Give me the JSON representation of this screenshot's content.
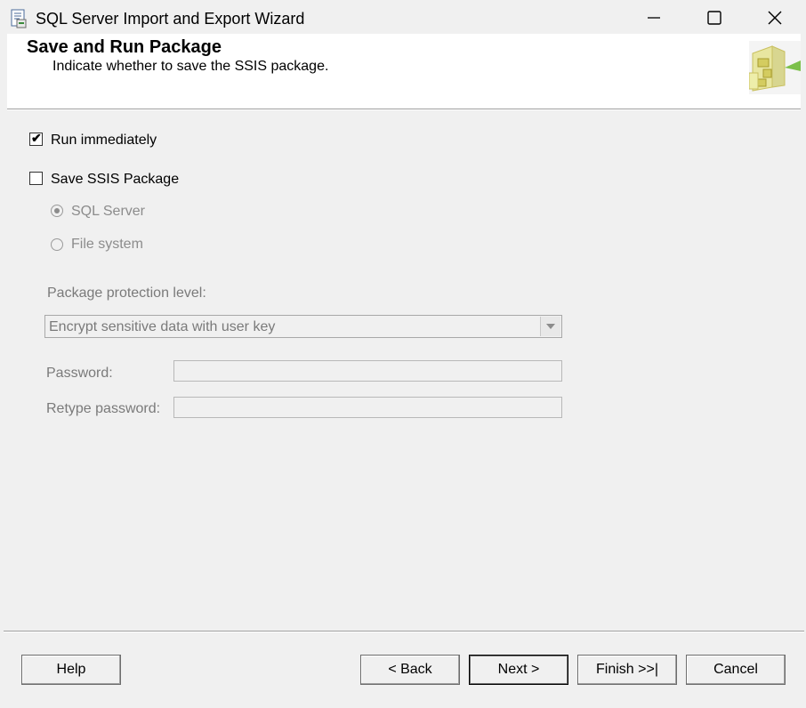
{
  "window": {
    "title": "SQL Server Import and Export Wizard",
    "controls": [
      "minimize",
      "maximize",
      "close"
    ]
  },
  "header": {
    "title": "Save and Run Package",
    "subtitle": "Indicate whether to save the SSIS package."
  },
  "options": {
    "run_immediately": {
      "label": "Run immediately",
      "checked": true
    },
    "save_package": {
      "label": "Save SSIS Package",
      "checked": false
    },
    "sql_server": {
      "label": "SQL Server",
      "selected": true,
      "enabled": false
    },
    "file_system": {
      "label": "File system",
      "selected": false,
      "enabled": false
    }
  },
  "protection": {
    "label": "Package protection level:",
    "selected": "Encrypt sensitive data with user key"
  },
  "password": {
    "label": "Password:",
    "value": ""
  },
  "retype_password": {
    "label": "Retype password:",
    "value": ""
  },
  "buttons": {
    "help": "Help",
    "back": "< Back",
    "next": "Next >",
    "finish": "Finish >>|",
    "cancel": "Cancel"
  },
  "colors": {
    "background": "#f0f0f0",
    "header_bg": "#ffffff",
    "disabled_text": "#8c8c8c"
  }
}
